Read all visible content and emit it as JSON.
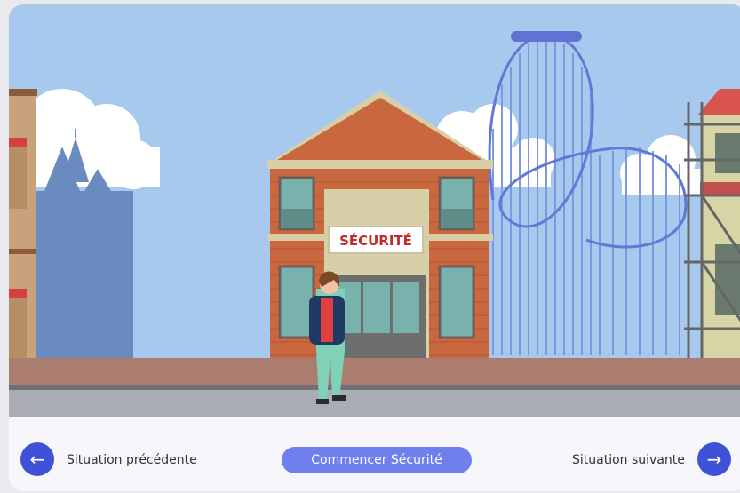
{
  "scene": {
    "building_sign": "SÉCURITÉ"
  },
  "footer": {
    "prev_label": "Situation précédente",
    "start_label": "Commencer Sécurité",
    "next_label": "Situation suivante",
    "prev_icon": "arrow-left-icon",
    "next_icon": "arrow-right-icon",
    "accent_color": "#3f51d6",
    "button_color": "#6f7fee"
  }
}
